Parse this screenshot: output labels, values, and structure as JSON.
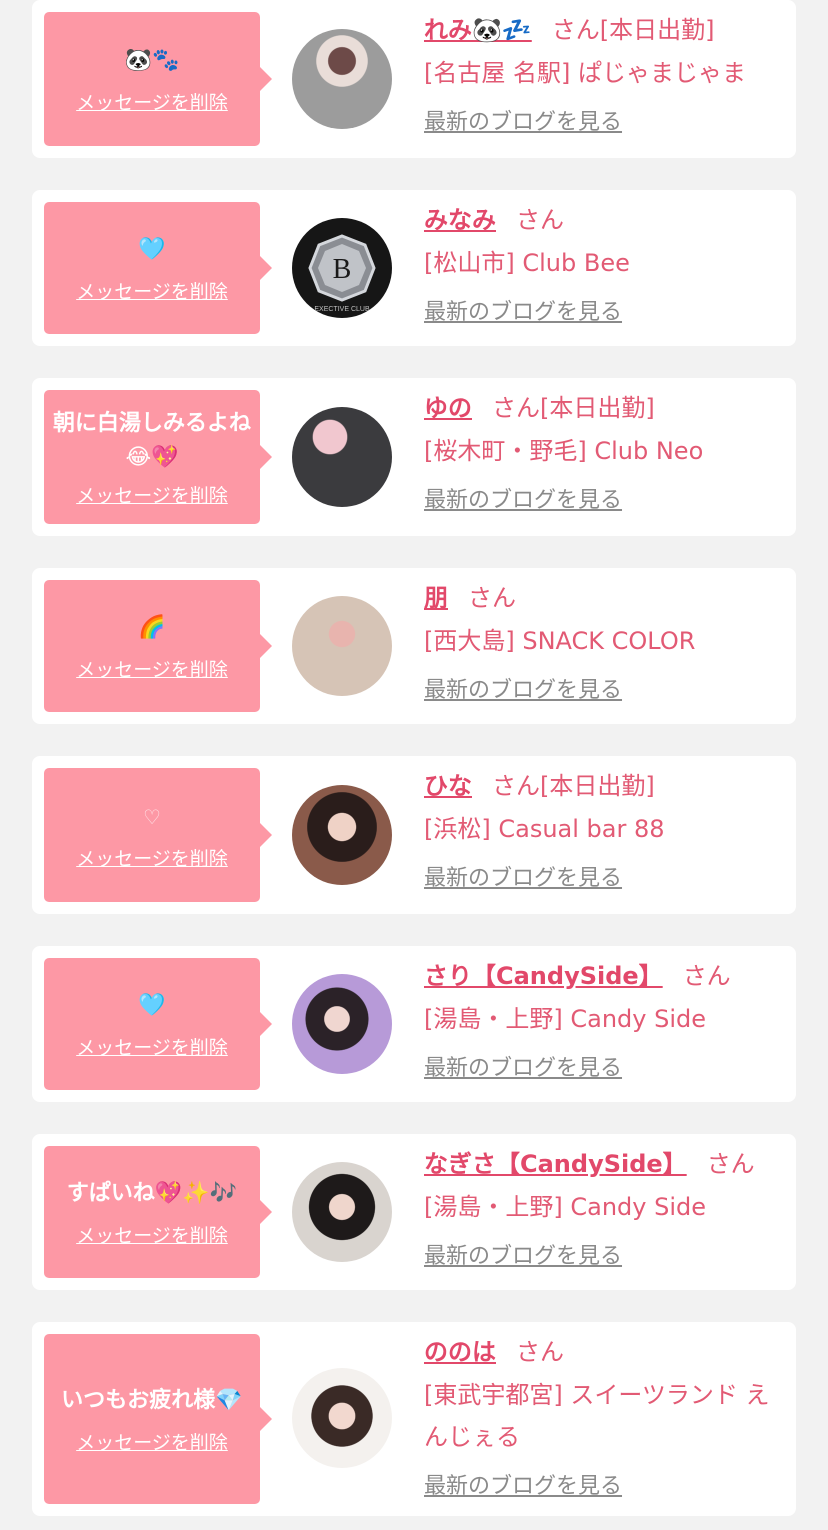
{
  "colors": {
    "bubble": "#fd98a5",
    "accent": "#e2486a",
    "text": "#e25a74",
    "link_gray": "#8a8a8a",
    "background": "#f2f2f2"
  },
  "labels": {
    "delete": "メッセージを削除",
    "blog": "最新のブログを見る",
    "honorific": "さん"
  },
  "items": [
    {
      "message": "🐼🐾",
      "name": "れみ🐼💤",
      "status": "[本日出勤]",
      "shop": "[名古屋 名駅] ぱじゃまじゃま",
      "avatar": "avatar-photo"
    },
    {
      "message": "🩵",
      "name": "みなみ",
      "status": "",
      "shop": "[松山市] Club Bee",
      "avatar": "club-logo-b",
      "logo_letter": "B",
      "logo_sub": "EXECTIVE CLUB"
    },
    {
      "message": "朝に白湯しみるよね😂💖",
      "name": "ゆの",
      "status": "[本日出勤]",
      "shop": "[桜木町・野毛] Club Neo",
      "avatar": "avatar-photo"
    },
    {
      "message": "🌈",
      "name": "朋",
      "status": "",
      "shop": "[西大島] SNACK COLOR",
      "avatar": "avatar-photo"
    },
    {
      "message": "♡",
      "name": "ひな",
      "status": "[本日出勤]",
      "shop": "[浜松] Casual bar 88",
      "avatar": "avatar-photo"
    },
    {
      "message": "🩵",
      "name": "さり【CandySide】",
      "status": "",
      "shop": "[湯島・上野] Candy Side",
      "avatar": "avatar-photo"
    },
    {
      "message": "すぱいね💖✨🎶",
      "name": "なぎさ【CandySide】",
      "status": "",
      "shop": "[湯島・上野] Candy Side",
      "avatar": "avatar-photo"
    },
    {
      "message": "いつもお疲れ様💎",
      "name": "ののは",
      "status": "",
      "shop": "[東武宇都宮] スイーツランド えんじぇる",
      "avatar": "avatar-photo"
    }
  ]
}
